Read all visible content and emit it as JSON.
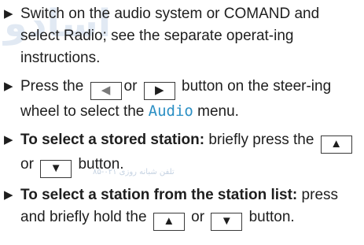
{
  "watermark": {
    "main": "اسادو",
    "sub": "تلفن شبانه روزی ۰۲۱-۸۵"
  },
  "icons": {
    "bullet": "triangle-right-icon",
    "left_button": "left-arrow-button-icon",
    "right_button": "right-arrow-button-icon",
    "up_button": "up-arrow-button-icon",
    "down_button": "down-arrow-button-icon"
  },
  "colors": {
    "text": "#1e1e1e",
    "accent": "#2b8fc4",
    "watermark": "#c9d8ea"
  },
  "steps": [
    {
      "text": "Switch on the audio system or COMAND and select Radio; see the separate operat-ing instructions."
    },
    {
      "pre": "Press the",
      "or": "or",
      "post_1": "button on the steer-ing wheel to select the",
      "highlight": "Audio",
      "post_2": "menu."
    },
    {
      "bold": "To select a stored station:",
      "post_1": "briefly press the",
      "or": "or",
      "post_2": "button."
    },
    {
      "bold": "To select a station from the station list:",
      "post_1": "press and briefly hold the",
      "or": "or",
      "post_2": "button."
    }
  ]
}
